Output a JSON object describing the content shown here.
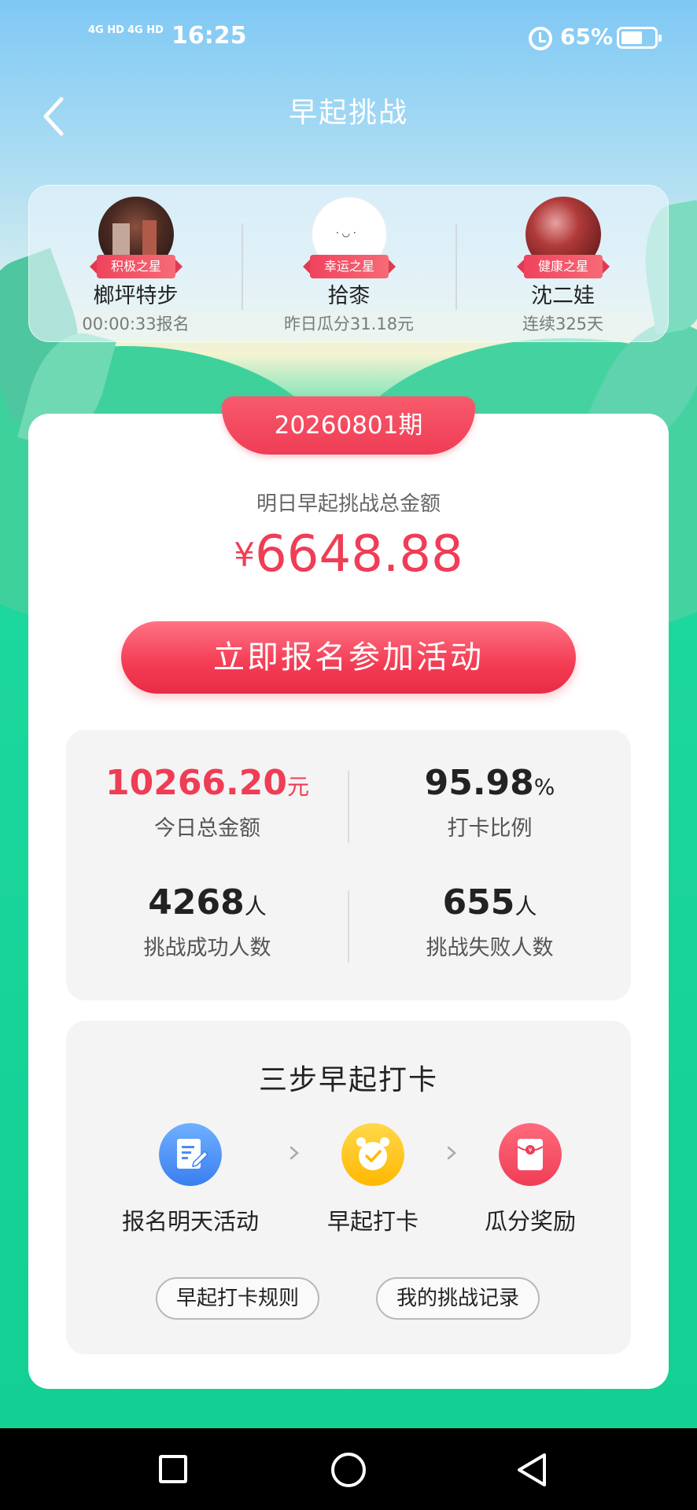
{
  "status_bar": {
    "network_1": "4G HD",
    "network_2": "4G HD",
    "time": "16:25",
    "battery": "65%"
  },
  "header": {
    "title": "早起挑战"
  },
  "stars": [
    {
      "badge": "积极之星",
      "name": "榔坪特步",
      "info": "00:00:33报名"
    },
    {
      "badge": "幸运之星",
      "name": "拾桼",
      "info": "昨日瓜分31.18元"
    },
    {
      "badge": "健康之星",
      "name": "沈二娃",
      "info": "连续325天"
    }
  ],
  "main": {
    "period": "20260801期",
    "total_label": "明日早起挑战总金额",
    "currency": "¥",
    "total_amount": "6648.88",
    "join_button": "立即报名参加活动"
  },
  "stats": {
    "today_total": {
      "value": "10266.20",
      "unit": "元",
      "label": "今日总金额"
    },
    "checkin_ratio": {
      "value": "95.98",
      "unit": "%",
      "label": "打卡比例"
    },
    "success_count": {
      "value": "4268",
      "unit": "人",
      "label": "挑战成功人数"
    },
    "fail_count": {
      "value": "655",
      "unit": "人",
      "label": "挑战失败人数"
    }
  },
  "steps": {
    "title": "三步早起打卡",
    "items": [
      {
        "label": "报名明天活动",
        "icon": "signup-doc-icon"
      },
      {
        "label": "早起打卡",
        "icon": "alarm-clock-icon"
      },
      {
        "label": "瓜分奖励",
        "icon": "red-envelope-icon"
      }
    ],
    "rules_button": "早起打卡规则",
    "records_button": "我的挑战记录"
  },
  "colors": {
    "accent_red": "#ef3d55",
    "sky_blue": "#7fc8f4",
    "green": "#13cf93"
  }
}
